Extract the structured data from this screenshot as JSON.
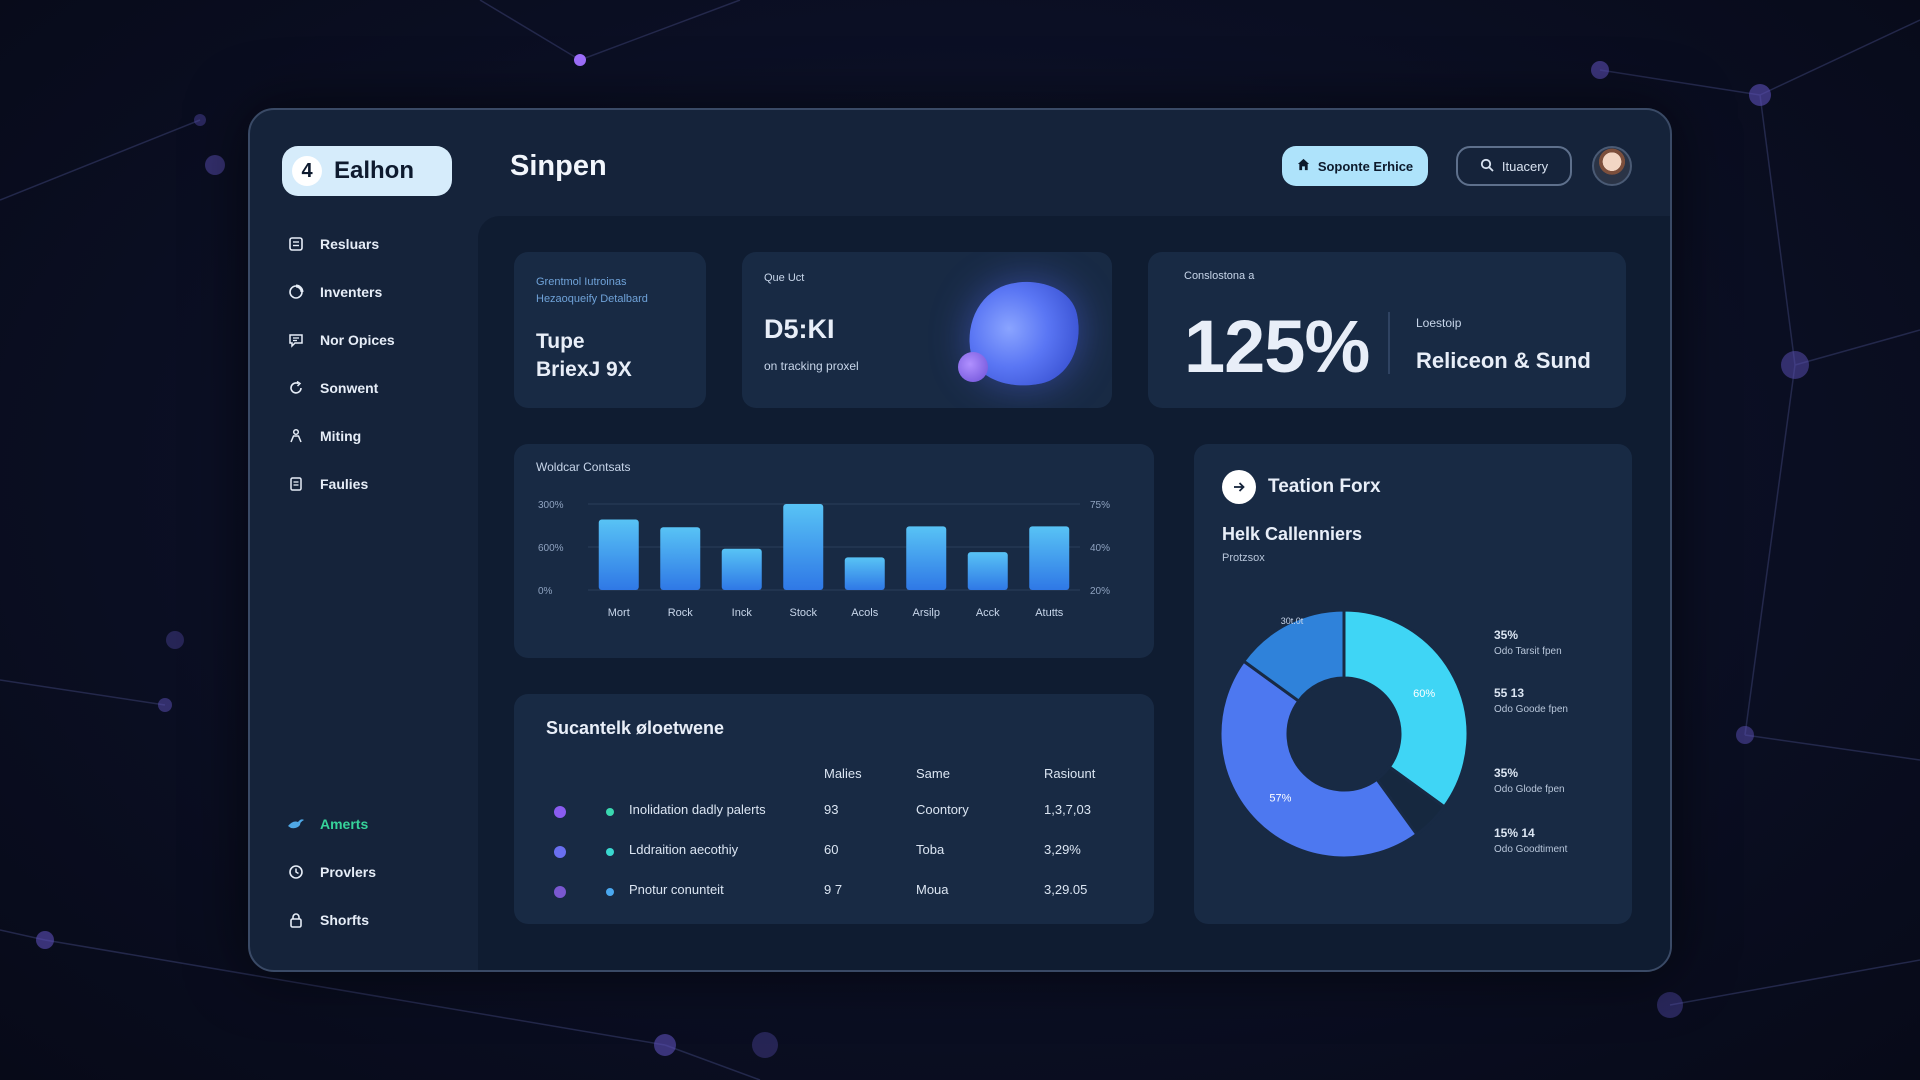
{
  "app": {
    "logo_number": "4",
    "logo_text": "Ealhon",
    "page_title": "Sinpen"
  },
  "header": {
    "primary_button": "Soponte Erhice",
    "search_button": "Ituacery"
  },
  "sidebar": {
    "items": [
      {
        "label": "Resluars",
        "icon": "clipboard-icon"
      },
      {
        "label": "Inventers",
        "icon": "circle-icon"
      },
      {
        "label": "Nor Opices",
        "icon": "chat-icon"
      },
      {
        "label": "Sonwent",
        "icon": "refresh-icon"
      },
      {
        "label": "Miting",
        "icon": "person-icon"
      },
      {
        "label": "Faulies",
        "icon": "document-icon"
      }
    ],
    "bottom_items": [
      {
        "label": "Amerts",
        "icon": "bird-icon",
        "active": true
      },
      {
        "label": "Provlers",
        "icon": "clock-icon",
        "active": false
      },
      {
        "label": "Shorfts",
        "icon": "lock-icon",
        "active": false
      }
    ]
  },
  "cards": {
    "card1": {
      "subtitle_line1": "Grentmol Iutroinas",
      "subtitle_line2": "Hezaoqueify Detalbard",
      "line1": "Tupe",
      "line2": "BriexJ 9X"
    },
    "card2": {
      "small": "Que Uct",
      "big": "D5:KI",
      "desc": "on tracking proxel"
    },
    "card3": {
      "small": "Conslostona a",
      "percent": "125%",
      "label": "Loestoip",
      "value": "Reliceon & Sund"
    },
    "table": {
      "title": "Sucantelk øloetwene",
      "headers": [
        "Malies",
        "Same",
        "Rasiount"
      ],
      "rows": [
        {
          "name": "Inolidation dadly palerts",
          "c1": "93",
          "c2": "Coontory",
          "c3": "1,3,7,03",
          "dot1": "#8a5cf0",
          "dot2": "#3ad8b0"
        },
        {
          "name": "Lddraition aecothiy",
          "c1": "60",
          "c2": "Toba",
          "c3": "3,29%",
          "dot1": "#6a6ff0",
          "dot2": "#3ad8d0"
        },
        {
          "name": "Pnotur conunteit",
          "c1": "9 7",
          "c2": "Moua",
          "c3": "3,29.05",
          "dot1": "#7a58d0",
          "dot2": "#4aa8f0"
        }
      ]
    },
    "donut_card": {
      "title": "Teation Forx",
      "subtitle": "Helk Callenniers",
      "subsmall": "Protzsox",
      "note": "30t.0t"
    }
  },
  "chart_data": [
    {
      "type": "bar",
      "title": "Woldcar Contsats",
      "categories": [
        "Mort",
        "Rock",
        "Inck",
        "Stock",
        "Acols",
        "Arsilp",
        "Acck",
        "Atutts"
      ],
      "values": [
        82,
        73,
        48,
        100,
        38,
        74,
        44,
        74
      ],
      "y_ticks_left": [
        "300%",
        "600%",
        "0%"
      ],
      "y_ticks_right": [
        "75%",
        "40%",
        "20%"
      ],
      "ylim": [
        0,
        100
      ],
      "color_top": "#58c3f5",
      "color_bottom": "#2f78e6"
    },
    {
      "type": "pie",
      "slices": [
        {
          "label": "60%",
          "value": 35,
          "color": "#3fd5f5"
        },
        {
          "label": "",
          "value": 5,
          "color": "#16283f"
        },
        {
          "label": "57%",
          "value": 45,
          "color": "#4d78f0"
        },
        {
          "label": "",
          "value": 15,
          "color": "#2f82da"
        }
      ],
      "legend": [
        {
          "value": "35%",
          "label": "Odo Tarsit fpen"
        },
        {
          "value": "55 13",
          "label": "Odo Goode fpen"
        },
        {
          "value": "35%",
          "label": "Odo Glode fpen"
        },
        {
          "value": "15% 14",
          "label": "Odo Goodtiment"
        }
      ]
    }
  ]
}
